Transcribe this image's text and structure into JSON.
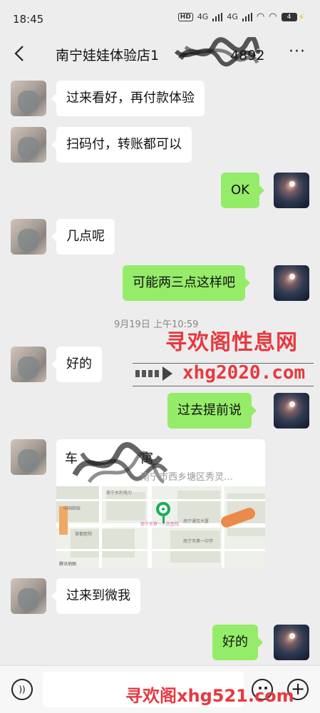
{
  "status_bar": {
    "time": "18:45",
    "hd": "HD",
    "network_1": "4G",
    "network_2": "4G",
    "battery": "4"
  },
  "header": {
    "title": "南宁娃娃体验店1",
    "title_suffix": "4892",
    "more": "···"
  },
  "messages": [
    {
      "side": "in",
      "text": "过来看好，再付款体验"
    },
    {
      "side": "in",
      "text": "扫码付，转账都可以"
    },
    {
      "side": "out",
      "text": "OK"
    },
    {
      "side": "in",
      "text": "几点呢"
    },
    {
      "side": "out",
      "text": "可能两三点这样吧"
    },
    {
      "side": "in",
      "text": "好的"
    },
    {
      "side": "out",
      "text": "过去提前说"
    },
    {
      "side": "in",
      "text": "过来到微我"
    },
    {
      "side": "out",
      "text": "好的"
    }
  ],
  "timestamp": "9月19日 上午10:59",
  "location_card": {
    "name": "车",
    "name_end": "寓",
    "address": "南宁市西乡塘区秀灵…",
    "map_labels": [
      "南宁水利电力",
      "中国邮政",
      "南宁市第一人民医院",
      "南宁通宝大厦",
      "首都医院",
      "南宁市第一人民医院",
      "南宁市第一中学",
      "腾讯地图"
    ]
  },
  "watermarks": {
    "top": "寻欢阁性息网",
    "url": "xhg2020.com",
    "bottom": "寻欢阁xhg521.com"
  },
  "icons": {
    "back": "chevron-left-icon",
    "voice": "voice-icon",
    "emoji": "emoji-icon",
    "plus": "plus-icon"
  }
}
